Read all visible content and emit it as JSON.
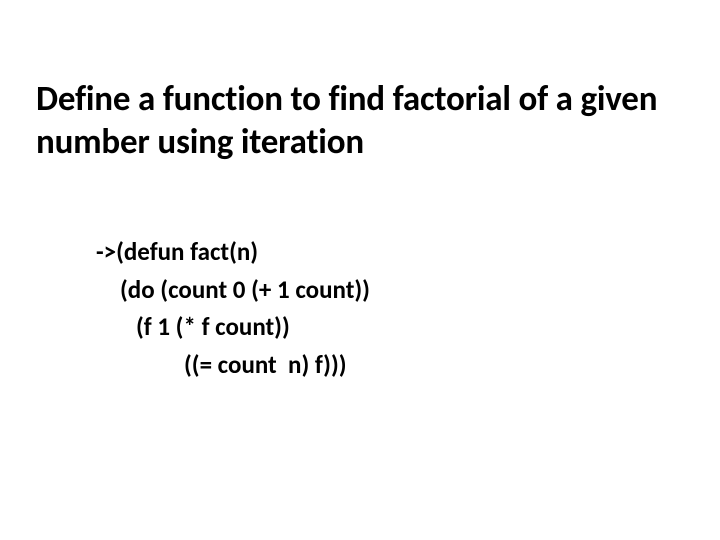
{
  "slide": {
    "title": "Define a function to find factorial of a given number using iteration",
    "code": {
      "line1": "->(defun fact(n)",
      "line2": "(do (count 0 (+ 1 count))",
      "line3": "(f 1 (* f count))",
      "line4": "((= count  n) f)))"
    }
  }
}
